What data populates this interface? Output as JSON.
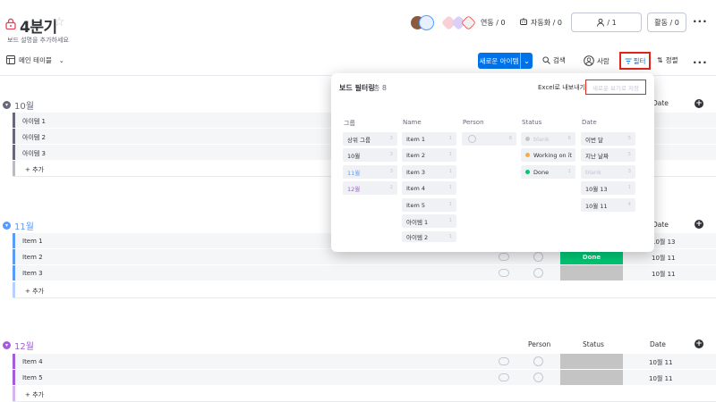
{
  "header": {
    "title": "4분기",
    "subtitle": "보드 설명을 추가하세요",
    "integrations_label": "연동 / 0",
    "automations_label": "자동화 / 0",
    "members_count": "/ 1",
    "activity_label": "활동 / 0",
    "more": "..."
  },
  "toolbar": {
    "main_table_label": "메인 테이블",
    "new_item_label": "새로운 아이템",
    "search_label": "검색",
    "person_label": "사람",
    "filter_label": "필터",
    "sort_label": "정렬",
    "more": "..."
  },
  "columns": {
    "person": "Person",
    "status": "Status",
    "date": "Date"
  },
  "groups": [
    {
      "title": "10월",
      "color": "#676879",
      "items": [
        "아이템 1",
        "아이템 2",
        "아이템 3"
      ],
      "add_label": "+ 추가",
      "date_header": "Date"
    },
    {
      "title": "11월",
      "color": "#579bfc",
      "items": [
        "Item 1",
        "Item 2",
        "Item 3"
      ],
      "add_label": "+ 추가",
      "date_header": "Date",
      "statuses": [
        "",
        "Done",
        ""
      ],
      "dates": [
        "10월 13",
        "10월 11",
        "10월 11"
      ]
    },
    {
      "title": "12월",
      "color": "#a25ddc",
      "items": [
        "Item 4",
        "Item 5"
      ],
      "add_label": "+ 추가",
      "statuses": [
        "",
        ""
      ],
      "dates": [
        "10월 11",
        "10월 11"
      ]
    }
  ],
  "colors": {
    "done": "#00c875",
    "working": "#fdab3d",
    "blank": "#c4c4c4",
    "accent": "#0073ea",
    "highlight": "#e2231a"
  },
  "filter_panel": {
    "title": "보드 필터링",
    "count": "총 8",
    "export_label": "Excel로 내보내기",
    "save_label": "새로운 보기로 저장",
    "columns": {
      "group": {
        "header": "그룹",
        "chips": [
          {
            "label": "상위 그룹",
            "count": "3"
          },
          {
            "label": "10월",
            "count": "3"
          },
          {
            "label": "11월",
            "count": "3"
          },
          {
            "label": "12월",
            "count": "2"
          }
        ]
      },
      "name": {
        "header": "Name",
        "chips": [
          {
            "label": "Item 1",
            "count": "1"
          },
          {
            "label": "Item 2",
            "count": "1"
          },
          {
            "label": "Item 3",
            "count": "1"
          },
          {
            "label": "Item 4",
            "count": "1"
          },
          {
            "label": "Item 5",
            "count": "1"
          },
          {
            "label": "아이템 1",
            "count": "1"
          },
          {
            "label": "아이템 2",
            "count": "1"
          }
        ]
      },
      "person": {
        "header": "Person",
        "chips": [
          {
            "label": "",
            "count": "8"
          }
        ]
      },
      "status": {
        "header": "Status",
        "chips": [
          {
            "label": "blank",
            "count": "6"
          },
          {
            "label": "Working on it",
            "count": "1"
          },
          {
            "label": "Done",
            "count": "1"
          }
        ]
      },
      "date": {
        "header": "Date",
        "chips": [
          {
            "label": "이번 달",
            "count": "5"
          },
          {
            "label": "지난 날짜",
            "count": "5"
          },
          {
            "label": "blank",
            "count": "3"
          },
          {
            "label": "10월 13",
            "count": "1"
          },
          {
            "label": "10월 11",
            "count": "4"
          }
        ]
      }
    }
  }
}
